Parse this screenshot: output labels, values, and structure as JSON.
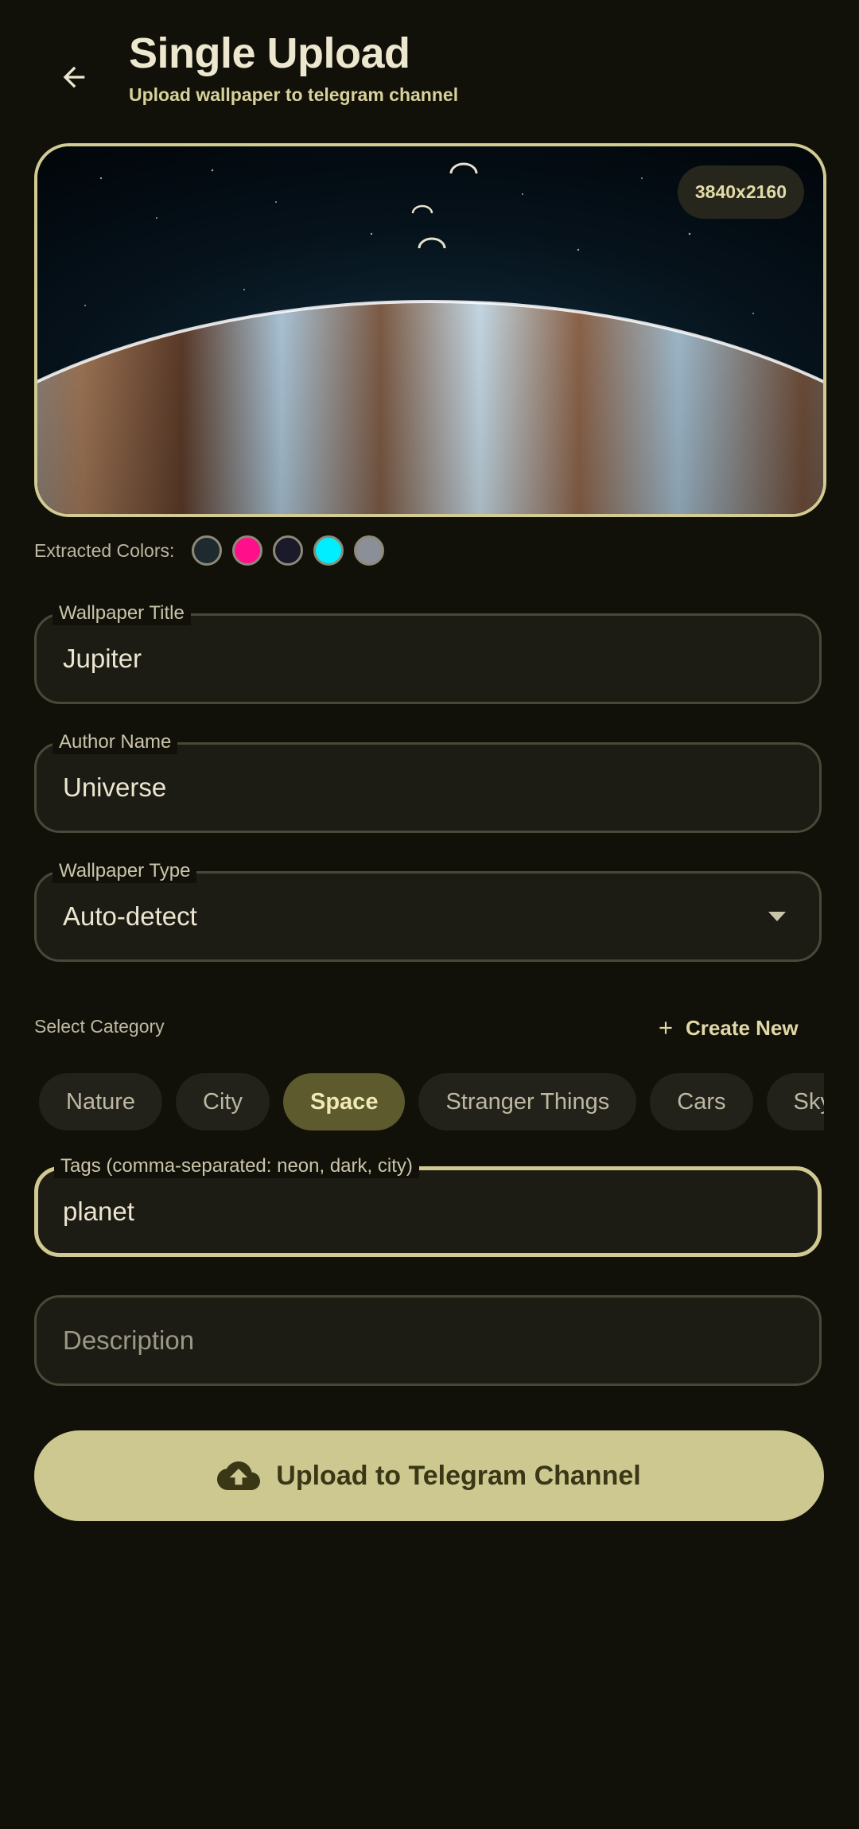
{
  "header": {
    "title": "Single Upload",
    "subtitle": "Upload wallpaper to telegram channel"
  },
  "preview": {
    "resolution": "3840x2160"
  },
  "colors": {
    "label": "Extracted Colors:",
    "swatches": [
      "#1E2A30",
      "#FF0F8A",
      "#1B1A2A",
      "#00EEFF",
      "#8B8F98"
    ]
  },
  "fields": {
    "title": {
      "label": "Wallpaper Title",
      "value": "Jupiter"
    },
    "author": {
      "label": "Author Name",
      "value": "Universe"
    },
    "type": {
      "label": "Wallpaper Type",
      "value": "Auto-detect"
    },
    "tags": {
      "label": "Tags (comma-separated: neon, dark, city)",
      "value": "planet"
    },
    "description": {
      "placeholder": "Description"
    }
  },
  "category": {
    "label": "Select Category",
    "create_new": "Create New",
    "chips": [
      "Nature",
      "City",
      "Space",
      "Stranger Things",
      "Cars",
      "Sky"
    ],
    "selected": "Space"
  },
  "upload": {
    "label": "Upload to Telegram Channel"
  }
}
